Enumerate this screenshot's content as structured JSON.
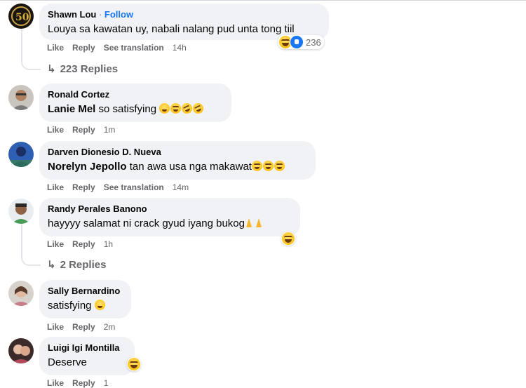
{
  "comments": [
    {
      "name": "Shawn Lou",
      "follow": "Follow",
      "text": "Louya sa kawatan uy, nabali nalang pud unta tong tiil",
      "actions": [
        "Like",
        "Reply",
        "See translation"
      ],
      "time": "14h",
      "reaction_count": "236",
      "replies": "223 Replies"
    },
    {
      "name": "Ronald Cortez",
      "mention": "Lanie Mel",
      "text": " so satisfying ",
      "actions": [
        "Like",
        "Reply"
      ],
      "time": "1m"
    },
    {
      "name": "Darven Dionesio D. Nueva",
      "mention": "Norelyn Jepollo",
      "text": " tan awa usa nga makawat",
      "actions": [
        "Like",
        "Reply",
        "See translation"
      ],
      "time": "14m"
    },
    {
      "name": "Randy Perales Banono",
      "text": "hayyyy salamat ni crack gyud iyang bukog",
      "actions": [
        "Like",
        "Reply"
      ],
      "time": "1h",
      "replies": "2 Replies"
    },
    {
      "name": "Sally Bernardino",
      "text": "satisfying ",
      "actions": [
        "Like",
        "Reply"
      ],
      "time": "2m"
    },
    {
      "name": "Luigi Igi Montilla",
      "text": "Deserve",
      "actions": [
        "Like",
        "Reply"
      ],
      "time": "1"
    }
  ],
  "colors": {
    "bubble": "#f0f2f5",
    "meta": "#65676b",
    "link": "#1877f2"
  }
}
